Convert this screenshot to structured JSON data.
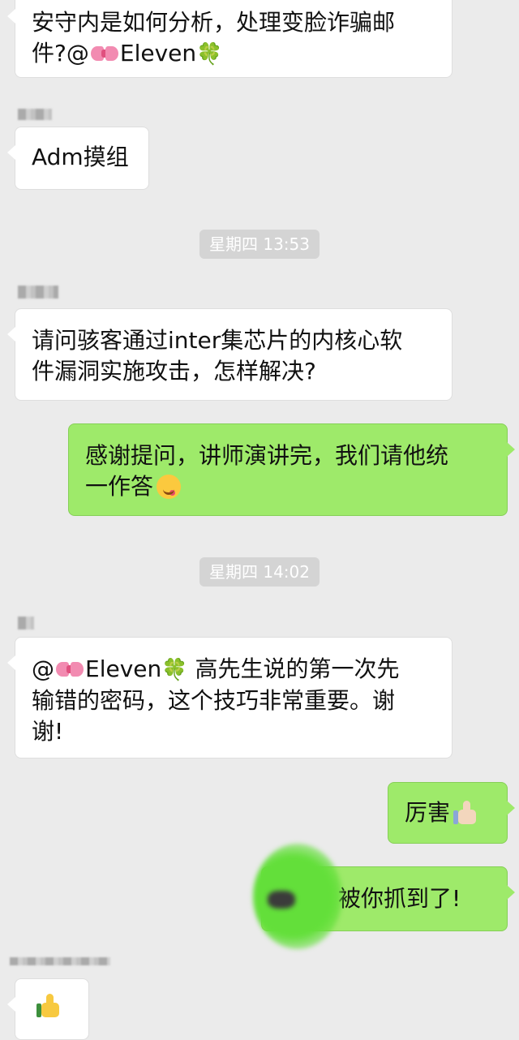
{
  "messages": {
    "m1": {
      "line1": "安守内是如何分析，处理变脸诈骗邮",
      "line2_prefix": "件?@",
      "mention": "Eleven",
      "clover": "🍀"
    },
    "m2": {
      "text": "Adm摸组"
    },
    "time1": "星期四 13:53",
    "m3": {
      "line1": "请问骇客通过inter集芯片的内核心软",
      "line2": "件漏洞实施攻击，怎样解决?"
    },
    "m4": {
      "line1": "感谢提问，讲师演讲完，我们请他统",
      "line2": "一作答"
    },
    "time2": "星期四 14:02",
    "m5": {
      "prefix": "@",
      "mention": "Eleven",
      "clover": "🍀",
      "line1_rest": " 高先生说的第一次先",
      "line2": "输错的密码，这个技巧非常重要。谢",
      "line3": "谢!"
    },
    "m6": {
      "text": "厉害"
    },
    "m7": {
      "text": "被你抓到了!"
    }
  },
  "colors": {
    "background": "#ebebeb",
    "incoming": "#ffffff",
    "outgoing": "#9eea6a",
    "time_pill": "#d4d4d4"
  },
  "icons": [
    "bow-emoji",
    "clover-emoji",
    "yum-emoji",
    "thumbs-up-emoji",
    "thumbs-up-sticker"
  ]
}
